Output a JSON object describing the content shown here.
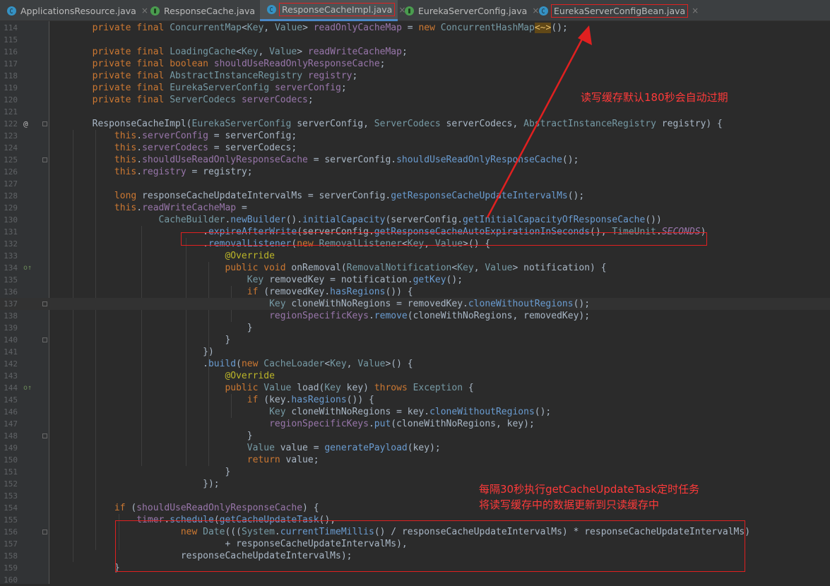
{
  "tabs": [
    {
      "label": "ApplicationsResource.java",
      "icon": "class-icon"
    },
    {
      "label": "ResponseCache.java",
      "icon": "interface-icon"
    },
    {
      "label": "ResponseCacheImpl.java",
      "icon": "class-icon"
    },
    {
      "label": "EurekaServerConfig.java",
      "icon": "interface-icon"
    },
    {
      "label": "EurekaServerConfigBean.java",
      "icon": "class-icon"
    }
  ],
  "tab_close_glyph": "×",
  "gutter_marks": {
    "at": "@",
    "override": "o↑"
  },
  "annotations": {
    "expire_note": "读写缓存默认180秒会自动过期",
    "timer_note_line1": "每隔30秒执行getCacheUpdateTask定时任务",
    "timer_note_line2": "将读写缓存中的数据更新到只读缓存中"
  },
  "code_lines": [
    {
      "n": "114",
      "code": "        private final ConcurrentMap<Key, Value> readOnlyCacheMap = new ConcurrentHashMap<~>();"
    },
    {
      "n": "115",
      "code": ""
    },
    {
      "n": "116",
      "code": "        private final LoadingCache<Key, Value> readWriteCacheMap;"
    },
    {
      "n": "117",
      "code": "        private final boolean shouldUseReadOnlyResponseCache;"
    },
    {
      "n": "118",
      "code": "        private final AbstractInstanceRegistry registry;"
    },
    {
      "n": "119",
      "code": "        private final EurekaServerConfig serverConfig;"
    },
    {
      "n": "120",
      "code": "        private final ServerCodecs serverCodecs;"
    },
    {
      "n": "121",
      "code": ""
    },
    {
      "n": "122",
      "code": "        ResponseCacheImpl(EurekaServerConfig serverConfig, ServerCodecs serverCodecs, AbstractInstanceRegistry registry) {"
    },
    {
      "n": "123",
      "code": "            this.serverConfig = serverConfig;"
    },
    {
      "n": "124",
      "code": "            this.serverCodecs = serverCodecs;"
    },
    {
      "n": "125",
      "code": "            this.shouldUseReadOnlyResponseCache = serverConfig.shouldUseReadOnlyResponseCache();"
    },
    {
      "n": "126",
      "code": "            this.registry = registry;"
    },
    {
      "n": "127",
      "code": ""
    },
    {
      "n": "128",
      "code": "            long responseCacheUpdateIntervalMs = serverConfig.getResponseCacheUpdateIntervalMs();"
    },
    {
      "n": "129",
      "code": "            this.readWriteCacheMap ="
    },
    {
      "n": "130",
      "code": "                    CacheBuilder.newBuilder().initialCapacity(serverConfig.getInitialCapacityOfResponseCache())"
    },
    {
      "n": "131",
      "code": "                            .expireAfterWrite(serverConfig.getResponseCacheAutoExpirationInSeconds(), TimeUnit.SECONDS)"
    },
    {
      "n": "132",
      "code": "                            .removalListener(new RemovalListener<Key, Value>() {"
    },
    {
      "n": "133",
      "code": "                                @Override"
    },
    {
      "n": "134",
      "code": "                                public void onRemoval(RemovalNotification<Key, Value> notification) {"
    },
    {
      "n": "135",
      "code": "                                    Key removedKey = notification.getKey();"
    },
    {
      "n": "136",
      "code": "                                    if (removedKey.hasRegions()) {"
    },
    {
      "n": "137",
      "code": "                                        Key cloneWithNoRegions = removedKey.cloneWithoutRegions();"
    },
    {
      "n": "138",
      "code": "                                        regionSpecificKeys.remove(cloneWithNoRegions, removedKey);"
    },
    {
      "n": "139",
      "code": "                                    }"
    },
    {
      "n": "140",
      "code": "                                }"
    },
    {
      "n": "141",
      "code": "                            })"
    },
    {
      "n": "142",
      "code": "                            .build(new CacheLoader<Key, Value>() {"
    },
    {
      "n": "143",
      "code": "                                @Override"
    },
    {
      "n": "144",
      "code": "                                public Value load(Key key) throws Exception {"
    },
    {
      "n": "145",
      "code": "                                    if (key.hasRegions()) {"
    },
    {
      "n": "146",
      "code": "                                        Key cloneWithNoRegions = key.cloneWithoutRegions();"
    },
    {
      "n": "147",
      "code": "                                        regionSpecificKeys.put(cloneWithNoRegions, key);"
    },
    {
      "n": "148",
      "code": "                                    }"
    },
    {
      "n": "149",
      "code": "                                    Value value = generatePayload(key);"
    },
    {
      "n": "150",
      "code": "                                    return value;"
    },
    {
      "n": "151",
      "code": "                                }"
    },
    {
      "n": "152",
      "code": "                            });"
    },
    {
      "n": "153",
      "code": ""
    },
    {
      "n": "154",
      "code": "            if (shouldUseReadOnlyResponseCache) {"
    },
    {
      "n": "155",
      "code": "                timer.schedule(getCacheUpdateTask(),"
    },
    {
      "n": "156",
      "code": "                        new Date(((System.currentTimeMillis() / responseCacheUpdateIntervalMs) * responseCacheUpdateIntervalMs)"
    },
    {
      "n": "157",
      "code": "                                + responseCacheUpdateIntervalMs),"
    },
    {
      "n": "158",
      "code": "                        responseCacheUpdateIntervalMs);"
    },
    {
      "n": "159",
      "code": "            }"
    },
    {
      "n": "160",
      "code": ""
    }
  ],
  "colors": {
    "background": "#2b2b2b",
    "keyword": "#cc7832",
    "type": "#769aa5",
    "field": "#9876aa",
    "method": "#6a9cd1",
    "annotation": "#bbb529",
    "highlight_box": "#e02020",
    "note_text": "#ff3a3a"
  }
}
